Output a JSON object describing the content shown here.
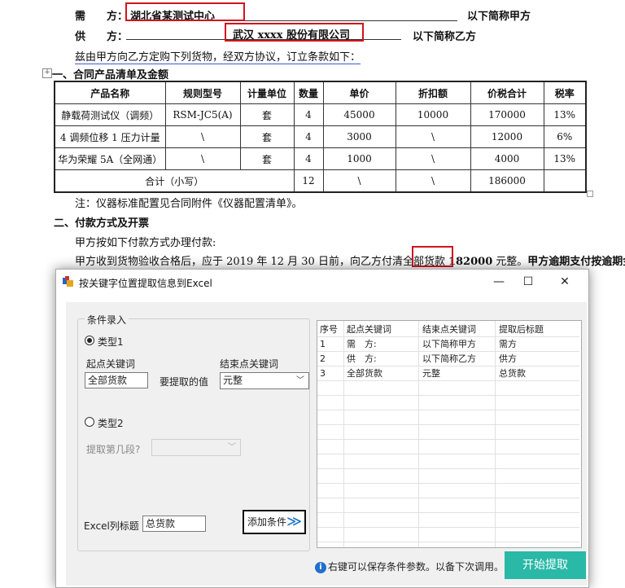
{
  "document": {
    "buyer_label": "需　　方：",
    "buyer_value": "湖北省某测试中心",
    "buyer_suffix": "以下简称甲方",
    "seller_label": "供　　方：",
    "seller_value": "武汉 xxxx 股份有限公司",
    "seller_suffix": "以下简称乙方",
    "intro": "兹由甲方向乙方定购下列货物，经双方协议，订立条款如下：",
    "section1": "一、合同产品清单及金额",
    "table": {
      "headers": [
        "产品名称",
        "规则型号",
        "计量单位",
        "数量",
        "单价",
        "折扣额",
        "价税合计",
        "税率"
      ],
      "rows": [
        [
          "静载荷测试仪（调频）",
          "RSM-JC5(A)",
          "套",
          "4",
          "45000",
          "10000",
          "170000",
          "13%"
        ],
        [
          "4 调频位移 1 压力计量",
          "\\",
          "套",
          "4",
          "3000",
          "\\",
          "12000",
          "6%"
        ],
        [
          "华为荣耀 5A（全网通）",
          "\\",
          "套",
          "4",
          "1000",
          "\\",
          "4000",
          "13%"
        ]
      ],
      "total": {
        "label": "合计（小写）",
        "qty": "12",
        "price": "\\",
        "discount": "\\",
        "sum": "186000",
        "rate": ""
      }
    },
    "note": "注：仪器标准配置见合同附件《仪器配置清单》。",
    "section2": "二、付款方式及开票",
    "pay1": "甲方按如下付款方式办理付款:",
    "pay2_a": "甲方收到货物验收合格后，应于 2019 年 12 月 30 日前，向乙方付清全部货款",
    "pay2_amount": "182000",
    "pay2_b": "元整。",
    "pay2_c": "甲方逾期支付按逾期金"
  },
  "dialog": {
    "title": "按关键字位置提取信息到Excel",
    "controls": {
      "minimize": "—",
      "maximize": "☐",
      "close": "✕"
    },
    "group_title": "条件录入",
    "type1_label": "类型1",
    "start_kw_label": "起点关键词",
    "start_kw_value": "全部货款",
    "extract_label": "要提取的值",
    "end_kw_label": "结束点关键词",
    "end_kw_value": "元整",
    "type2_label": "类型2",
    "segment_label": "提取第几段?",
    "segment_value": "",
    "excel_col_label": "Excel列标题",
    "excel_col_value": "总货款",
    "add_button": "添加条件",
    "grid": {
      "headers": [
        "序号",
        "起点关键词",
        "结束点关键词",
        "提取后标题"
      ],
      "rows": [
        [
          "1",
          "需　方:",
          "以下简称甲方",
          "需方"
        ],
        [
          "2",
          "供　方:",
          "以下简称乙方",
          "供方"
        ],
        [
          "3",
          "全部货款",
          "元整",
          "总货款"
        ]
      ]
    },
    "hint_text": "右键可以保存条件参数。以备下次调用。",
    "start_button": "开始提取",
    "colors": {
      "accent": "#2ab8a7",
      "highlight_box": "#d0141d",
      "info_icon": "#1f6fd0"
    }
  }
}
